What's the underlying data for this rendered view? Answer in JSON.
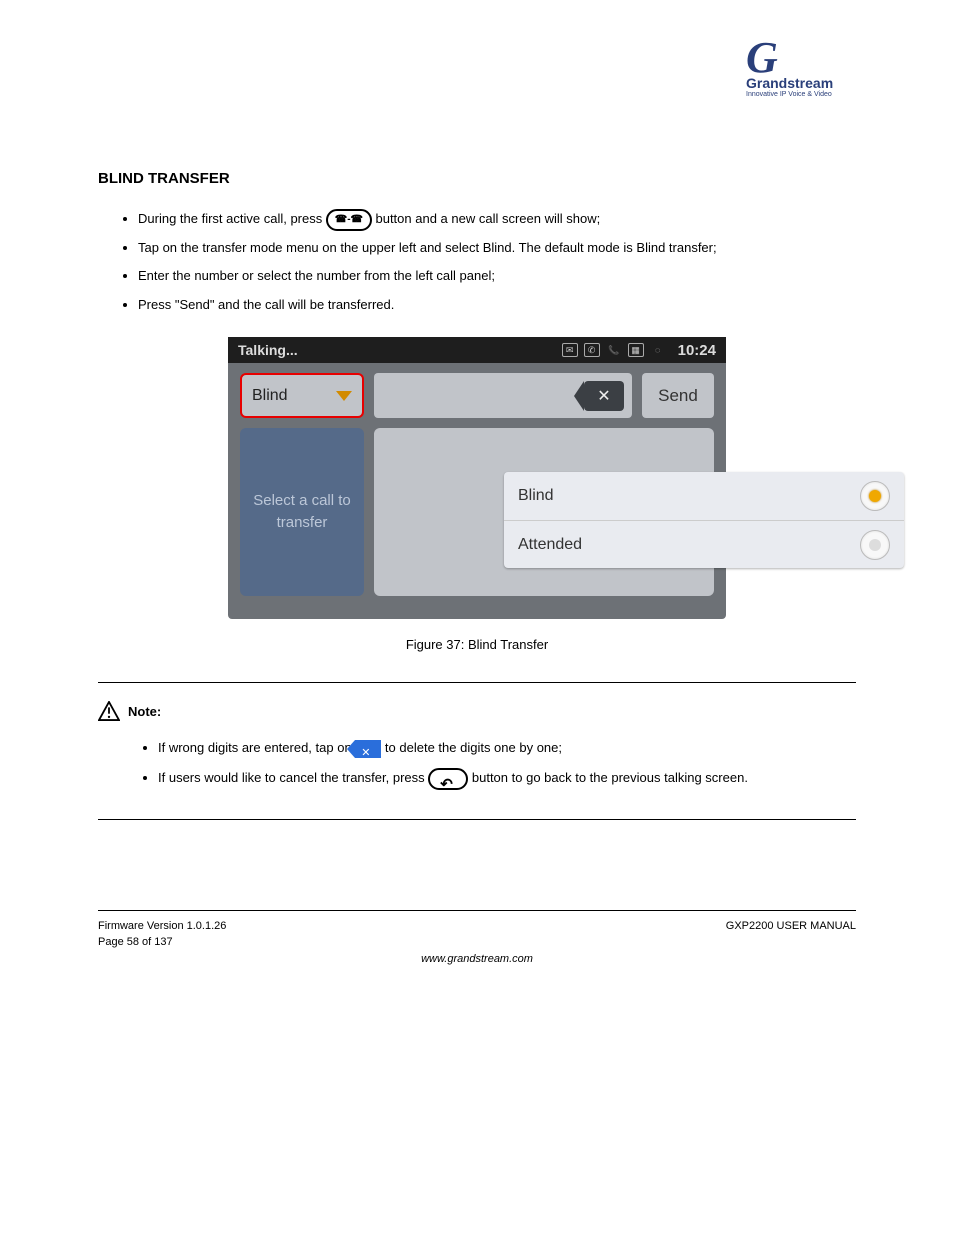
{
  "logo": {
    "brand": "Grandstream",
    "tagline": "Innovative IP Voice & Video"
  },
  "section": {
    "title": "BLIND TRANSFER"
  },
  "steps": [
    {
      "pre": "During the first active call, press ",
      "post": " button and a new call screen will show;"
    },
    {
      "text": "Tap on the transfer mode menu on the upper left and select Blind. The default mode is Blind transfer;"
    },
    {
      "text": "Enter the number or select the number from the left call panel;"
    },
    {
      "text": "Press \"Send\" and the call will be transferred."
    }
  ],
  "screenshot": {
    "status_left": "Talking...",
    "status_time": "10:24",
    "status_icons": [
      "mail-icon",
      "voice-icon",
      "phone-icon",
      "sim-icon",
      "sync-icon"
    ],
    "dropdown_current": "Blind",
    "send_label": "Send",
    "left_panel_text": "Select a call to transfer",
    "popup": [
      {
        "label": "Blind",
        "selected": true
      },
      {
        "label": "Attended",
        "selected": false
      }
    ]
  },
  "figure_caption": "Figure 37: Blind Transfer",
  "note": {
    "label": "Note:",
    "items": [
      {
        "pre": "If wrong digits are entered, tap on ",
        "post": " to delete the digits one by one;"
      },
      {
        "pre": "If users would like to cancel the transfer, press ",
        "post": " button to go back to the previous talking screen."
      }
    ]
  },
  "footer": {
    "left_line1": "Firmware Version 1.0.1.26",
    "left_line2": "Page 58 of 137",
    "right_line1": "GXP2200 USER MANUAL",
    "center": "www.grandstream.com"
  }
}
